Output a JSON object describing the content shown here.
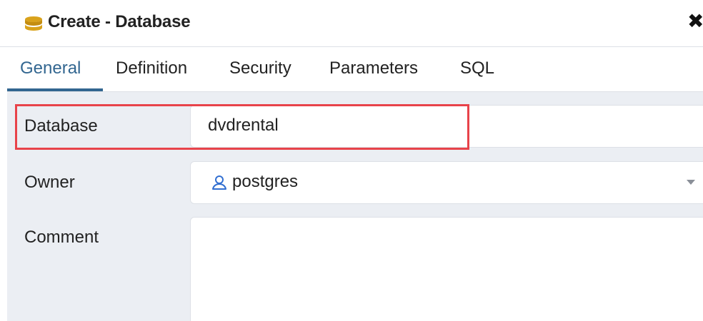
{
  "dialog": {
    "title": "Create - Database",
    "title_icon": "database-icon",
    "close_icon": "close-icon",
    "close_glyph": "✖"
  },
  "tabs": [
    {
      "label": "General",
      "active": true
    },
    {
      "label": "Definition",
      "active": false
    },
    {
      "label": "Security",
      "active": false
    },
    {
      "label": "Parameters",
      "active": false
    },
    {
      "label": "SQL",
      "active": false
    }
  ],
  "form": {
    "database": {
      "label": "Database",
      "value": "dvdrental"
    },
    "owner": {
      "label": "Owner",
      "value": "postgres",
      "icon": "user-icon"
    },
    "comment": {
      "label": "Comment",
      "value": ""
    }
  },
  "colors": {
    "accent": "#326690",
    "highlight": "#e8434a",
    "panel_bg": "#ebeef3",
    "db_icon": "#d9a21b"
  }
}
